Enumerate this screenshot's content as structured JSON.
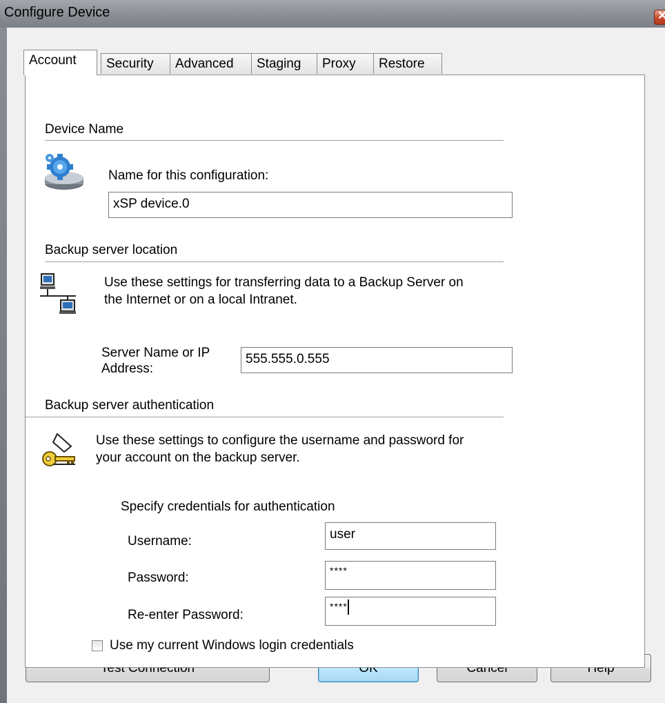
{
  "window": {
    "title": "Configure Device"
  },
  "tabs": [
    {
      "label": "Account",
      "active": true
    },
    {
      "label": "Security",
      "active": false
    },
    {
      "label": "Advanced",
      "active": false
    },
    {
      "label": "Staging",
      "active": false
    },
    {
      "label": "Proxy",
      "active": false
    },
    {
      "label": "Restore",
      "active": false
    }
  ],
  "device_name": {
    "heading": "Device Name",
    "icon": "gear-drive-icon",
    "config_label": "Name for this configuration:",
    "config_value": "xSP device.0"
  },
  "backup_location": {
    "heading": "Backup server location",
    "icon": "network-computers-icon",
    "description_line1": "Use these settings for transferring data to a Backup Server on",
    "description_line2": "the Internet or on a local Intranet.",
    "server_label_line1": "Server Name or IP",
    "server_label_line2": "Address:",
    "server_value": "555.555.0.555"
  },
  "authentication": {
    "heading": "Backup server authentication",
    "icon": "key-icon",
    "description_line1": "Use these settings to configure the username and password for",
    "description_line2": "your account on the backup server.",
    "credentials_heading": "Specify credentials for authentication",
    "username_label": "Username:",
    "username_value": "user",
    "password_label": "Password:",
    "password_value": "****",
    "reenter_label": "Re-enter Password:",
    "reenter_value": "****",
    "windows_login_label": "Use my current Windows login credentials",
    "windows_login_checked": false
  },
  "buttons": {
    "test_connection": "Test Connection",
    "ok": "OK",
    "cancel": "Cancel",
    "help": "Help"
  },
  "colors": {
    "dialog_bg": "#f0f0f0",
    "panel_bg": "#ffffff",
    "default_button": "#bee6fd",
    "close_button": "#c8462a"
  }
}
